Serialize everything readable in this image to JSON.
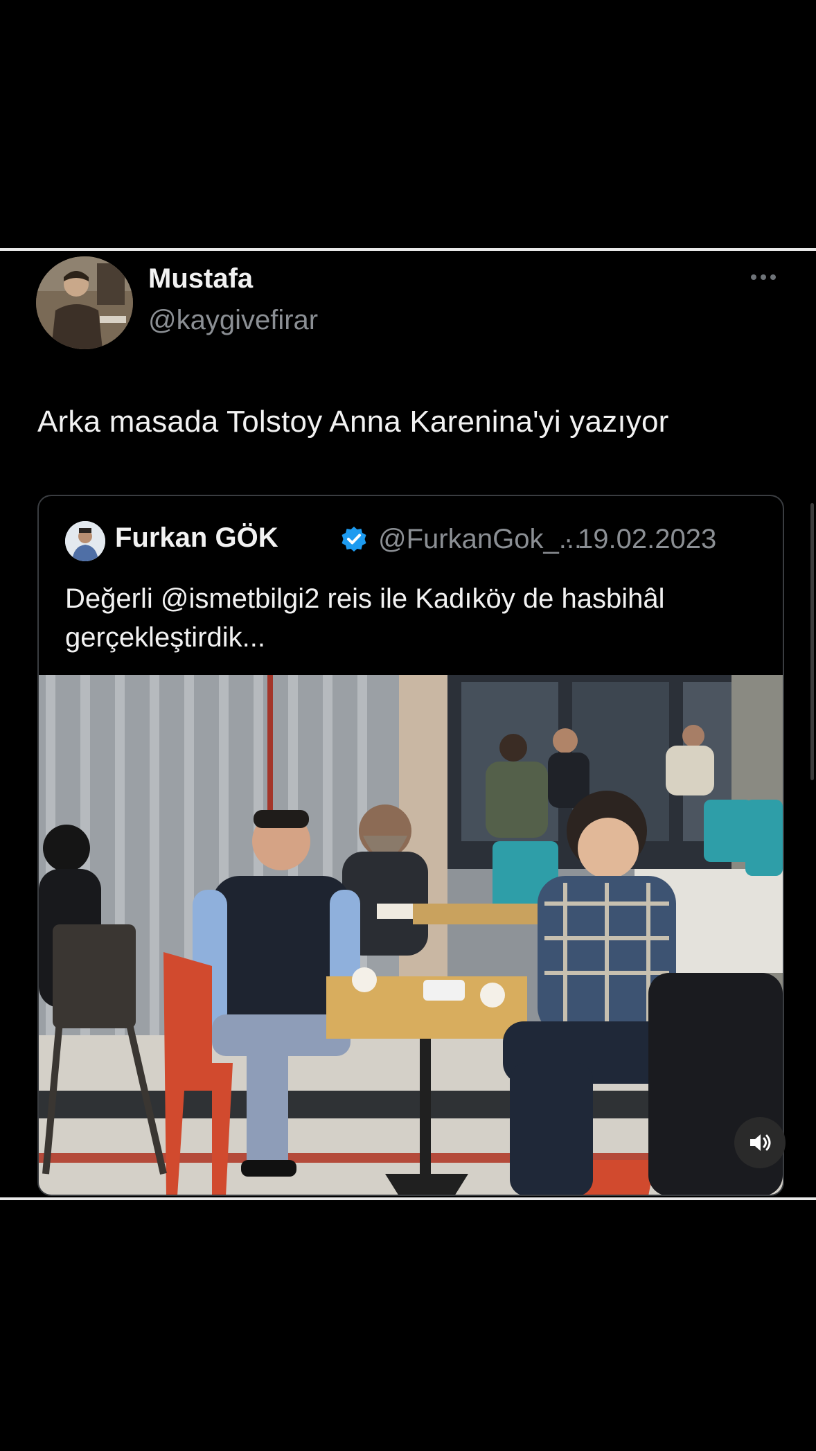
{
  "author": {
    "name": "Mustafa",
    "handle": "@kaygivefirar"
  },
  "tweet": {
    "text": "Arka masada Tolstoy Anna Karenina'yi yazıyor"
  },
  "quoted": {
    "name": "Furkan GÖK",
    "handle": "@FurkanGok_...",
    "separator": "·",
    "date": "19.02.2023",
    "text": "Değerli @ismetbilgi2 reis ile Kadıköy de hasbihâl gerçekleştirdik..."
  },
  "icons": {
    "more": "more-icon",
    "verified": "verified-badge-icon",
    "volume": "volume-icon"
  },
  "colors": {
    "background": "#000000",
    "text_primary": "#f2f2f2",
    "text_secondary": "#8b8f94",
    "verified": "#1d9bf0"
  }
}
